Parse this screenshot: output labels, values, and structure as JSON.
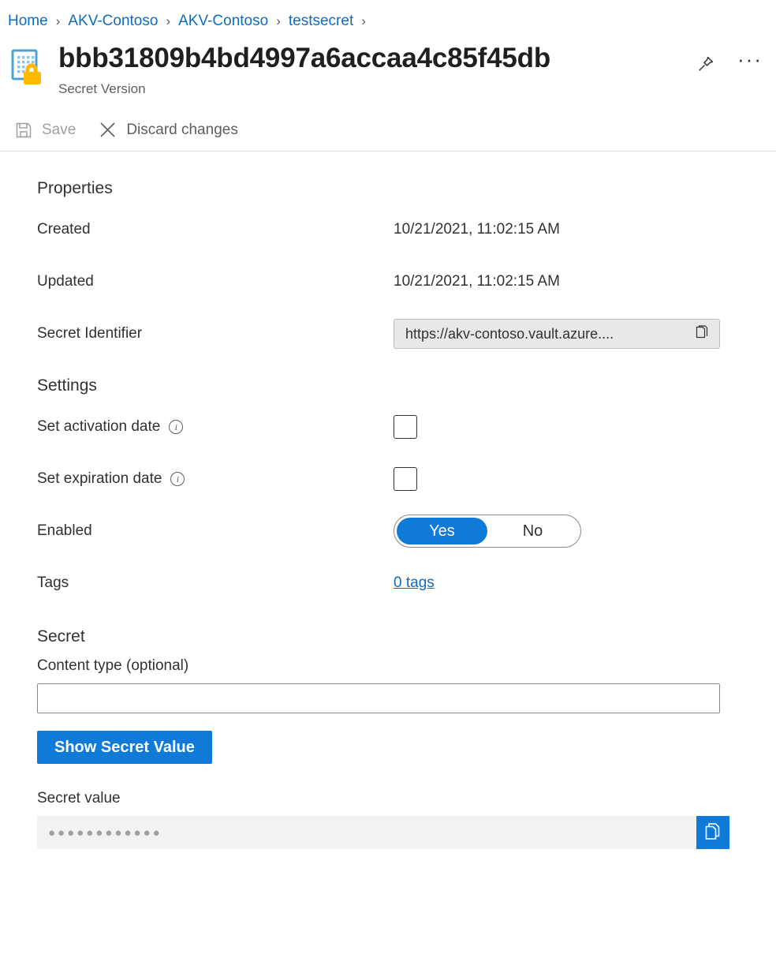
{
  "breadcrumb": {
    "items": [
      {
        "label": "Home"
      },
      {
        "label": "AKV-Contoso"
      },
      {
        "label": "AKV-Contoso"
      },
      {
        "label": "testsecret"
      }
    ],
    "separator": "›"
  },
  "header": {
    "title": "bbb31809b4bd4997a6accaa4c85f45db",
    "subtitle": "Secret Version",
    "pin_tooltip": "Pin to dashboard",
    "more_label": "···"
  },
  "commandbar": {
    "save_label": "Save",
    "discard_label": "Discard changes"
  },
  "properties": {
    "heading": "Properties",
    "created_label": "Created",
    "created_value": "10/21/2021, 11:02:15 AM",
    "updated_label": "Updated",
    "updated_value": "10/21/2021, 11:02:15 AM",
    "identifier_label": "Secret Identifier",
    "identifier_value": "https://akv-contoso.vault.azure...."
  },
  "settings": {
    "heading": "Settings",
    "activation_label": "Set activation date",
    "activation_checked": false,
    "expiration_label": "Set expiration date",
    "expiration_checked": false,
    "enabled_label": "Enabled",
    "enabled_yes": "Yes",
    "enabled_no": "No",
    "enabled_value": "Yes",
    "tags_label": "Tags",
    "tags_value": "0 tags"
  },
  "secret": {
    "heading": "Secret",
    "content_type_label": "Content type (optional)",
    "content_type_value": "",
    "content_type_placeholder": "",
    "show_button_label": "Show Secret Value",
    "secret_value_label": "Secret value",
    "secret_value_masked": "●●●●●●●●●●●●"
  },
  "colors": {
    "accent_blue": "#0f7ad8",
    "link_blue": "#0f6cbd",
    "icon_lock_yellow": "#ffb900",
    "icon_doc_blue": "#50a0d0",
    "text_primary": "#323130",
    "text_secondary": "#605e5c",
    "disabled_text": "#a19f9d",
    "field_gray": "#f3f2f1",
    "readonly_gray": "#e8e8e8"
  }
}
